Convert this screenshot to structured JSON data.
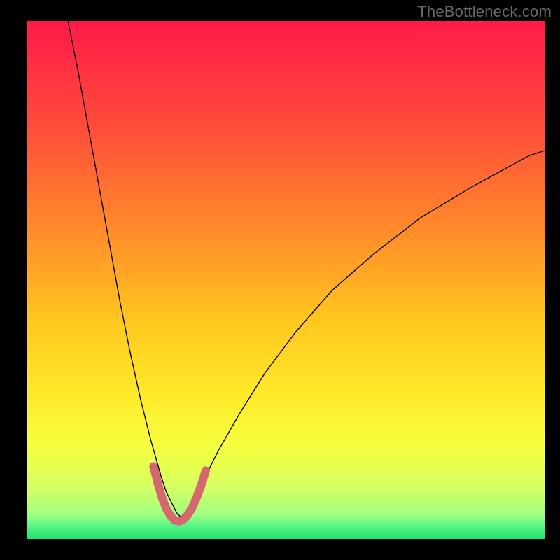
{
  "watermark": {
    "text": "TheBottleneck.com"
  },
  "chart_data": {
    "type": "line",
    "title": "",
    "xlabel": "",
    "ylabel": "",
    "xlim": [
      0,
      100
    ],
    "ylim": [
      0,
      100
    ],
    "grid": false,
    "legend": false,
    "annotations": [],
    "background_gradient_stops": [
      {
        "offset": 0.0,
        "color": "#ff1a49"
      },
      {
        "offset": 0.2,
        "color": "#ff4b3a"
      },
      {
        "offset": 0.4,
        "color": "#ff8a2a"
      },
      {
        "offset": 0.58,
        "color": "#ffc71f"
      },
      {
        "offset": 0.72,
        "color": "#ffe92a"
      },
      {
        "offset": 0.82,
        "color": "#f6ff3e"
      },
      {
        "offset": 0.9,
        "color": "#d6ff62"
      },
      {
        "offset": 0.955,
        "color": "#9dff82"
      },
      {
        "offset": 0.975,
        "color": "#55f586"
      },
      {
        "offset": 1.0,
        "color": "#22e06c"
      }
    ],
    "series": [
      {
        "name": "bottleneck-curve",
        "type": "line",
        "color": "#000000",
        "width": 1.4,
        "x": [
          8,
          10,
          12,
          14,
          16,
          18,
          20,
          22,
          24,
          26,
          27,
          28,
          29,
          30,
          31,
          32,
          34,
          37,
          41,
          46,
          52,
          59,
          67,
          76,
          86,
          97,
          100
        ],
        "y": [
          100,
          90,
          79,
          68,
          57,
          46,
          36,
          27,
          19,
          12,
          9,
          7,
          5,
          4,
          5,
          7,
          11,
          17,
          24,
          32,
          40,
          48,
          55,
          62,
          68,
          74,
          75
        ]
      },
      {
        "name": "ideal-zone",
        "type": "line",
        "color": "#d4686e",
        "width": 12,
        "linecap": "round",
        "linejoin": "round",
        "x": [
          24.5,
          25.4,
          26.2,
          27.0,
          27.8,
          28.6,
          29.4,
          30.2,
          31.0,
          31.9,
          32.8,
          33.7,
          34.6
        ],
        "y": [
          14.0,
          10.5,
          7.8,
          5.8,
          4.4,
          3.6,
          3.4,
          3.7,
          4.5,
          5.9,
          7.9,
          10.3,
          13.2
        ]
      }
    ]
  }
}
